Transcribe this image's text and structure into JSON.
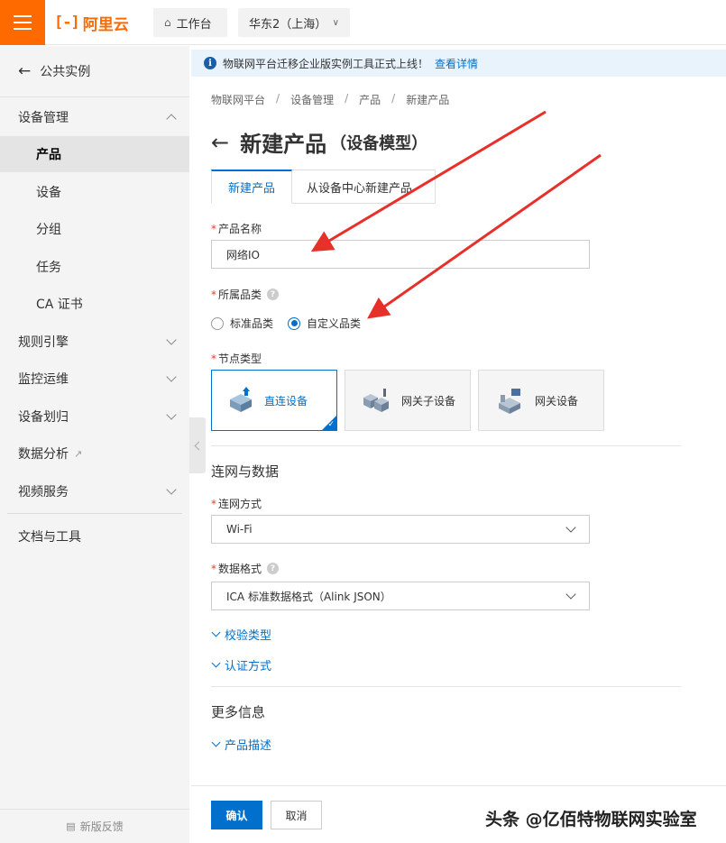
{
  "topbar": {
    "logo_text": "阿里云",
    "workbench": "工作台",
    "region": "华东2（上海）"
  },
  "sidebar": {
    "back_label": "公共实例",
    "items": [
      {
        "label": "设备管理",
        "type": "group",
        "expanded": true
      },
      {
        "label": "产品",
        "type": "sub",
        "active": true
      },
      {
        "label": "设备",
        "type": "sub"
      },
      {
        "label": "分组",
        "type": "sub"
      },
      {
        "label": "任务",
        "type": "sub"
      },
      {
        "label": "CA 证书",
        "type": "sub"
      },
      {
        "label": "规则引擎",
        "type": "group"
      },
      {
        "label": "监控运维",
        "type": "group"
      },
      {
        "label": "设备划归",
        "type": "group"
      },
      {
        "label": "数据分析",
        "type": "external"
      },
      {
        "label": "视频服务",
        "type": "group"
      },
      {
        "label": "文档与工具",
        "type": "plain"
      }
    ],
    "feedback": "新版反馈"
  },
  "notice": {
    "text": "物联网平台迁移企业版实例工具正式上线！",
    "link": "查看详情"
  },
  "breadcrumb": [
    "物联网平台",
    "设备管理",
    "产品",
    "新建产品"
  ],
  "page": {
    "title": "新建产品",
    "subtitle": "（设备模型）"
  },
  "tabs": [
    {
      "label": "新建产品",
      "active": true
    },
    {
      "label": "从设备中心新建产品",
      "active": false
    }
  ],
  "form": {
    "product_name_label": "产品名称",
    "product_name_value": "网络IO",
    "category_label": "所属品类",
    "category_options": [
      {
        "label": "标准品类",
        "checked": false
      },
      {
        "label": "自定义品类",
        "checked": true
      }
    ],
    "node_type_label": "节点类型",
    "node_types": [
      {
        "label": "直连设备",
        "selected": true
      },
      {
        "label": "网关子设备",
        "selected": false
      },
      {
        "label": "网关设备",
        "selected": false
      }
    ],
    "network_section": "连网与数据",
    "network_method_label": "连网方式",
    "network_method_value": "Wi-Fi",
    "data_format_label": "数据格式",
    "data_format_value": "ICA 标准数据格式（Alink JSON）",
    "verify_type": "校验类型",
    "auth_method": "认证方式",
    "more_section": "更多信息",
    "product_desc": "产品描述"
  },
  "actions": {
    "confirm": "确认",
    "cancel": "取消"
  },
  "watermark": "头条 @亿佰特物联网实验室",
  "colors": {
    "brand": "#ff6a00",
    "primary": "#0070cc",
    "annotation_arrow": "#e8302b"
  }
}
